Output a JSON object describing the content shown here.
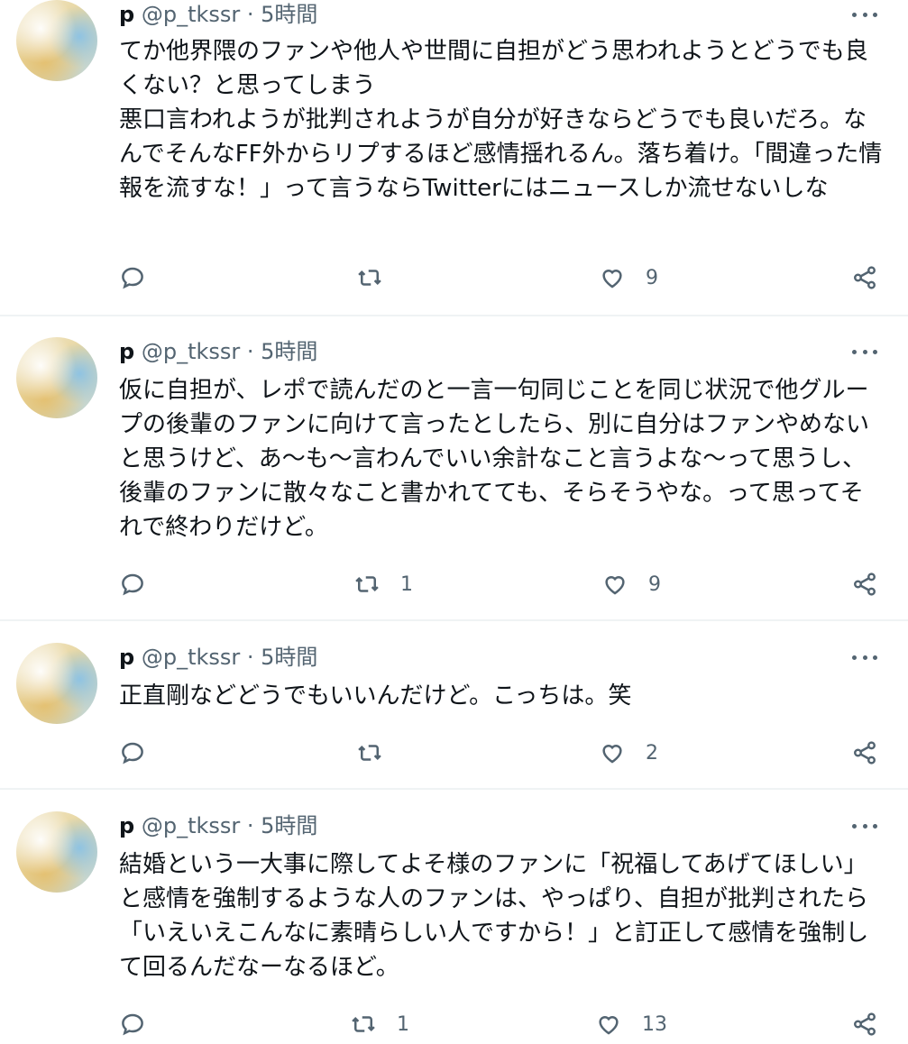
{
  "tweets": [
    {
      "name": "p",
      "handle": "@p_tkssr",
      "time": "· 5時間",
      "text": "てか他界隈のファンや他人や世間に自担がどう思われようとどうでも良くない？と思ってしまう\n悪口言われようが批判されようが自分が好きならどうでも良いだろ。なんでそんなFF外からリプするほど感情揺れるん。落ち着け。「間違った情報を流すな！」って言うならTwitterにはニュースしか流せないしな",
      "reply_count": "",
      "retweet_count": "",
      "like_count": "9"
    },
    {
      "name": "p",
      "handle": "@p_tkssr",
      "time": "· 5時間",
      "text": "仮に自担が、レポで読んだのと一言一句同じことを同じ状況で他グループの後輩のファンに向けて言ったとしたら、別に自分はファンやめないと思うけど、あ〜も〜言わんでいい余計なこと言うよな〜って思うし、後輩のファンに散々なこと書かれてても、そらそうやな。って思ってそれで終わりだけど。",
      "reply_count": "",
      "retweet_count": "1",
      "like_count": "9"
    },
    {
      "name": "p",
      "handle": "@p_tkssr",
      "time": "· 5時間",
      "text": "正直剛などどうでもいいんだけど。こっちは。笑",
      "reply_count": "",
      "retweet_count": "",
      "like_count": "2"
    },
    {
      "name": "p",
      "handle": "@p_tkssr",
      "time": "· 5時間",
      "text": "結婚という一大事に際してよそ様のファンに「祝福してあげてほしい」と感情を強制するような人のファンは、やっぱり、自担が批判されたら「いえいえこんなに素晴らしい人ですから！」と訂正して感情を強制して回るんだなーなるほど。",
      "reply_count": "",
      "retweet_count": "1",
      "like_count": "13"
    }
  ],
  "icons": {
    "reply": "reply-icon",
    "retweet": "retweet-icon",
    "like": "heart-icon",
    "share": "share-icon",
    "more": "more-icon"
  },
  "colors": {
    "text": "#0f1419",
    "secondary": "#536471",
    "divider": "#eff3f4"
  }
}
